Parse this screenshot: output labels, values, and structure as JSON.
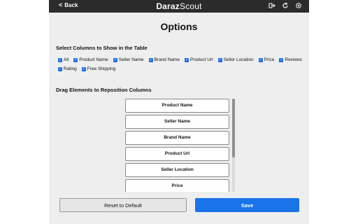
{
  "titlebar": {
    "back_label": "Back",
    "back_icon": "<",
    "brand_part1": "Daraz",
    "brand_part2": "Scout",
    "icons": [
      "export-icon",
      "refresh-icon",
      "settings-icon"
    ]
  },
  "page_title": "Options",
  "columns_section": {
    "label": "Select Columns to Show in the Table",
    "options": [
      {
        "label": "All",
        "checked": true
      },
      {
        "label": "Product Name",
        "checked": true
      },
      {
        "label": "Seller Name",
        "checked": true
      },
      {
        "label": "Brand Name",
        "checked": true
      },
      {
        "label": "Product Url",
        "checked": true
      },
      {
        "label": "Seller Location",
        "checked": true
      },
      {
        "label": "Price",
        "checked": true
      },
      {
        "label": "Reviews",
        "checked": true
      },
      {
        "label": "Rating",
        "checked": true
      },
      {
        "label": "Free Shipping",
        "checked": true
      }
    ]
  },
  "reorder_section": {
    "label": "Drag Elements to Reposition Columns",
    "items": [
      "Product Name",
      "Seller Name",
      "Brand Name",
      "Product Url",
      "Seller Location",
      "Price"
    ]
  },
  "buttons": {
    "reset_label": "Reset to Default",
    "save_label": "Save"
  },
  "colors": {
    "accent": "#1a73e8",
    "titlebar": "#2b2b2b",
    "panel_bg": "#eeeeee"
  }
}
